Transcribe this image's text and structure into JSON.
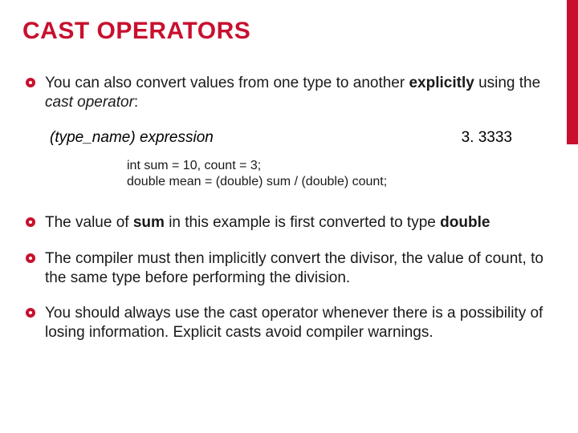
{
  "title": "CAST OPERATORS",
  "bullets": {
    "b1_part1": "You can also convert values from one type to another ",
    "b1_explicitly": "explicitly",
    "b1_part2": " using the ",
    "b1_castop": "cast operator",
    "b1_part3": ":",
    "b2_part1": "The value of ",
    "b2_sum": "sum",
    "b2_part2": " in this example is first converted to type ",
    "b2_double": "double",
    "b3": "The compiler must then implicitly convert the divisor, the value of count, to the same type before performing the division.",
    "b4": "You should always use the cast operator whenever there is a possibility of losing information. Explicit casts avoid compiler warnings."
  },
  "syntax": {
    "open": "(",
    "type_name": "type_name",
    "close_sp": ") ",
    "expression": "expression"
  },
  "result": "3. 3333",
  "code": {
    "line1": "int sum = 10, count = 3;",
    "line2": "double mean =  (double) sum / (double) count;"
  }
}
